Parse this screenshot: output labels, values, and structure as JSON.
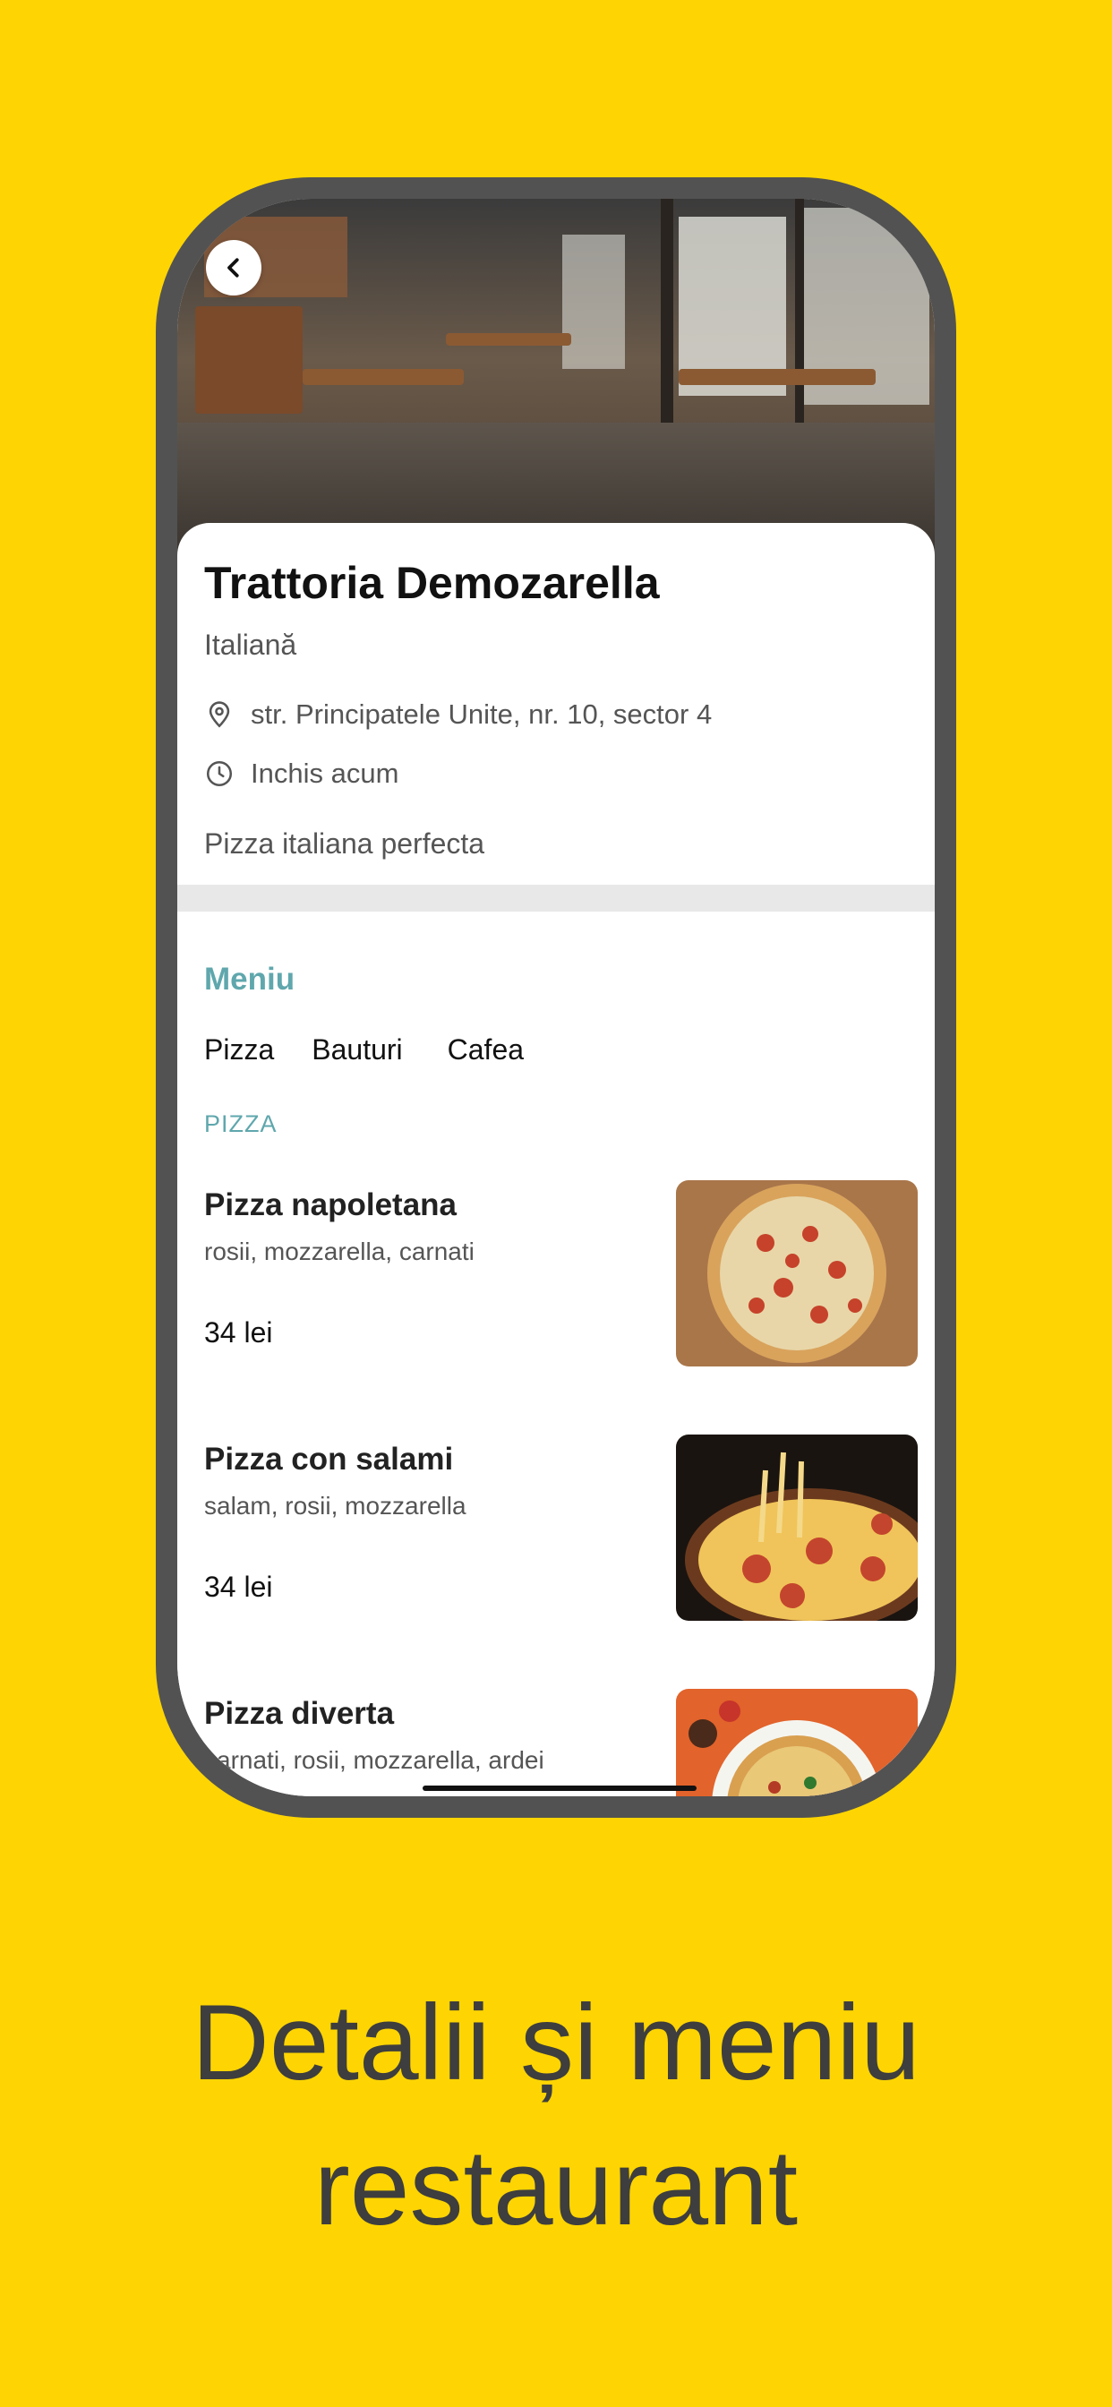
{
  "restaurant": {
    "name": "Trattoria Demozarella",
    "cuisine": "Italiană",
    "address": "str. Principatele Unite, nr. 10, sector 4",
    "status": "Inchis acum",
    "tagline": "Pizza italiana perfecta"
  },
  "menu": {
    "title": "Meniu",
    "tabs": [
      "Pizza",
      "Bauturi",
      "Cafea"
    ],
    "section_label": "PIZZA",
    "items": [
      {
        "name": "Pizza napoletana",
        "description": "rosii, mozzarella, carnati",
        "price": "34 lei"
      },
      {
        "name": "Pizza con salami",
        "description": "salam, rosii, mozzarella",
        "price": "34 lei"
      },
      {
        "name": "Pizza diverta",
        "description": "carnati, rosii, mozzarella, ardei",
        "price": ""
      }
    ]
  },
  "caption": {
    "line1": "Detalii și meniu",
    "line2": "restaurant"
  },
  "colors": {
    "background": "#FED502",
    "accent": "#5FA7AD",
    "phone_frame": "#525252"
  },
  "icons": {
    "back": "chevron-left-icon",
    "location": "location-pin-icon",
    "clock": "clock-icon"
  }
}
